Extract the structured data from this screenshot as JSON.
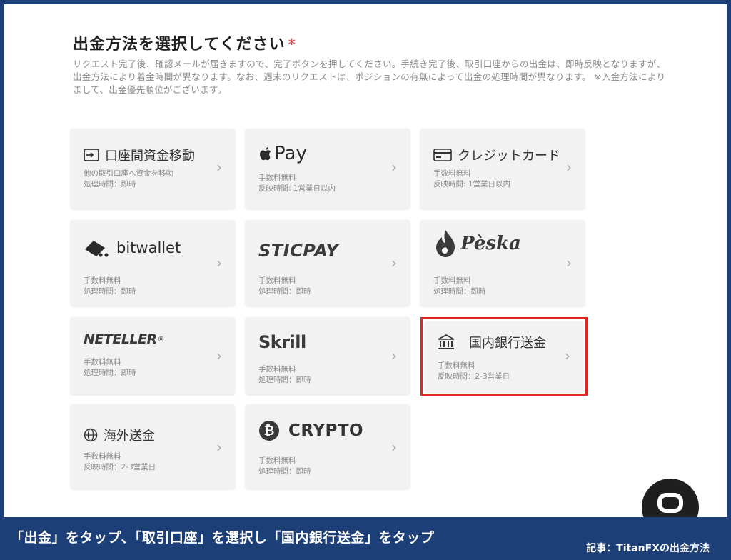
{
  "page": {
    "title": "出金方法を選択してください",
    "required_mark": "*",
    "description": "リクエスト完了後、確認メールが届きますので、完了ボタンを押してください。手続き完了後、取引口座からの出金は、即時反映となりますが、出金方法により着金時間が異なります。なお、週末のリクエストは、ポジションの有無によって出金の処理時間が異なります。 ※入金方法によりまして、出金優先順位がございます。"
  },
  "methods": [
    {
      "name": "口座間資金移動",
      "icon": "account-transfer-icon",
      "line1": "他の取引口座へ資金を移動",
      "line2": "処理時間：即時"
    },
    {
      "name": "Pay",
      "icon": "apple-icon",
      "line1": "手数料無料",
      "line2": "反映時間: 1営業日以内"
    },
    {
      "name": "クレジットカード",
      "icon": "credit-card-icon",
      "line1": "手数料無料",
      "line2": "反映時間: 1営業日以内"
    },
    {
      "name": "bitwallet",
      "icon": "bitwallet-logo-icon",
      "line1": "手数料無料",
      "line2": "処理時間：即時"
    },
    {
      "name": "STICPAY",
      "icon": "sticpay-logo",
      "line1": "手数料無料",
      "line2": "処理時間：即時"
    },
    {
      "name": "Pèska",
      "icon": "peska-flame-icon",
      "line1": "手数料無料",
      "line2": "処理時間：即時"
    },
    {
      "name": "NETELLER",
      "trademark": "®",
      "icon": "neteller-logo",
      "line1": "手数料無料",
      "line2": "処理時間：即時"
    },
    {
      "name": "Skrill",
      "icon": "skrill-logo",
      "line1": "手数料無料",
      "line2": "処理時間：即時"
    },
    {
      "name": "国内銀行送金",
      "icon": "bank-icon",
      "line1": "手数料無料",
      "line2": "反映時間：2-3営業日",
      "highlighted": true
    },
    {
      "name": "海外送金",
      "icon": "globe-icon",
      "line1": "手数料無料",
      "line2": "反映時間：2-3営業日"
    },
    {
      "name": "CRYPTO",
      "icon": "bitcoin-icon",
      "line1": "手数料無料",
      "line2": "処理時間：即時"
    }
  ],
  "caption": {
    "text": "「出金」をタップ、「取引口座」を選択し「国内銀行送金」をタップ",
    "source": "記事：TitanFXの出金方法"
  },
  "colors": {
    "frame": "#1d3f78",
    "highlight": "#e02626",
    "card": "#f2f2f2",
    "required": "#d93a3a"
  }
}
